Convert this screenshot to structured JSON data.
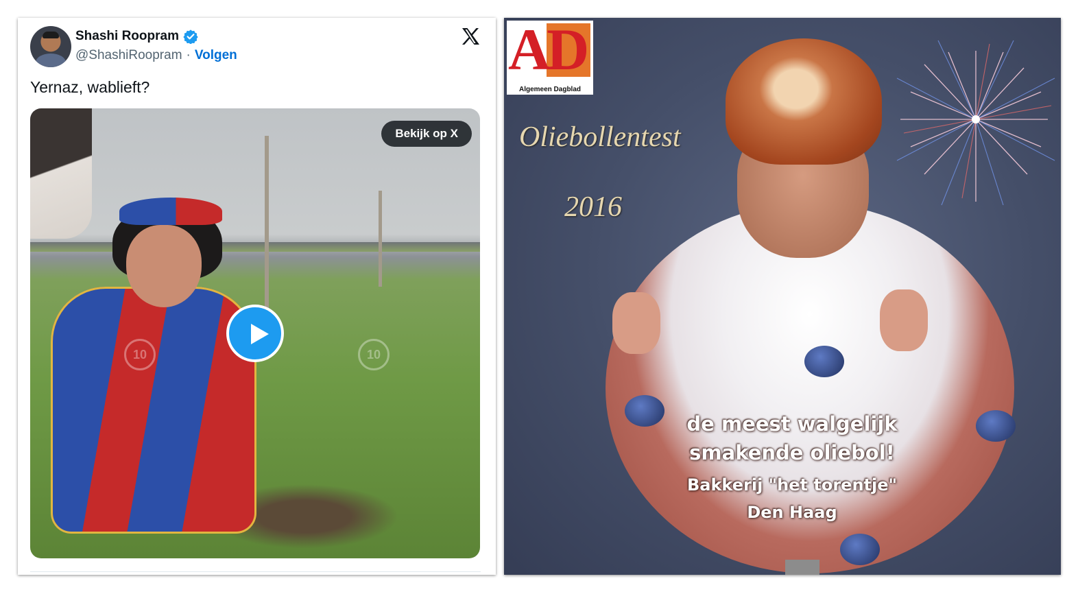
{
  "tweet": {
    "author_name": "Shashi Roopram",
    "handle": "@ShashiRoopram",
    "separator": "·",
    "follow_label": "Volgen",
    "text": "Yernaz, wablieft?",
    "media": {
      "watch_label": "Bekijk op X",
      "skip_back_label": "10",
      "skip_forward_label": "10"
    },
    "icons": {
      "verified": "verified-badge-icon",
      "platform": "x-logo-icon",
      "play": "play-icon"
    },
    "colors": {
      "follow": "#006fd6",
      "verified": "#1d9bf0",
      "play_button": "#1d9bf0"
    }
  },
  "meme": {
    "logo_letters": "AD",
    "logo_tagline": "Algemeen Dagblad",
    "title": "Oliebollentest",
    "year": "2016",
    "caption_line1": "de meest walgelijk",
    "caption_line2": "smakende oliebol!",
    "caption_line3": "Bakkerij \"het torentje\"",
    "caption_line4": "Den Haag",
    "colors": {
      "logo_red": "#d41f26",
      "logo_orange": "#e5762a",
      "title_gold": "#e6d7b0"
    }
  }
}
